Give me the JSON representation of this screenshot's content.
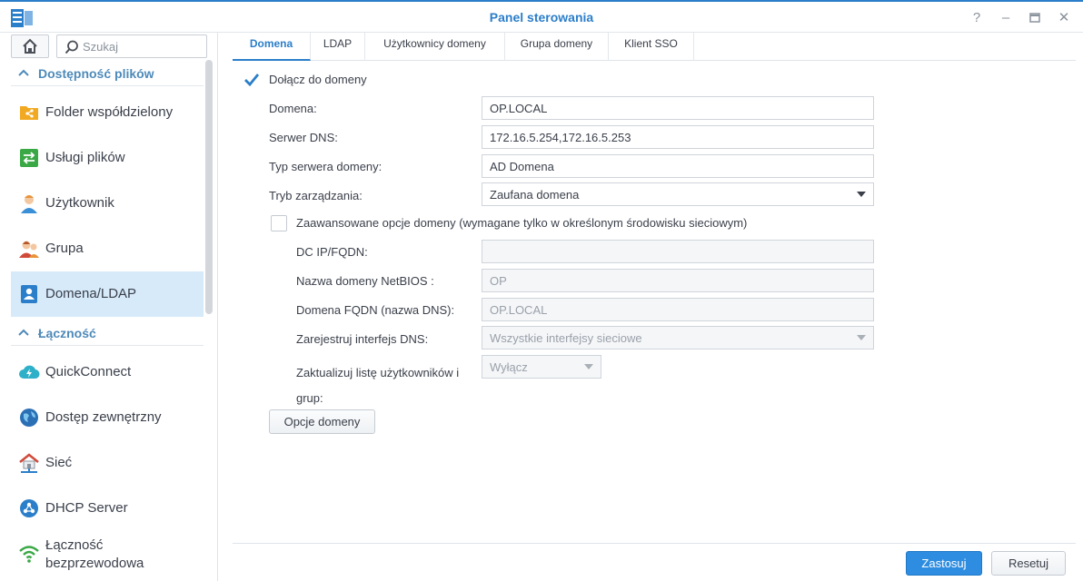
{
  "window": {
    "title": "Panel sterowania"
  },
  "colors": {
    "accent": "#2b7ec9",
    "active_bg": "#d6eaf9",
    "primary_button": "#2e8de0"
  },
  "search": {
    "placeholder": "Szukaj"
  },
  "sidebar": {
    "sections": [
      {
        "label": "Dostępność plików"
      },
      {
        "label": "Łączność"
      }
    ],
    "items": [
      {
        "label": "Folder współdzielony",
        "icon": "shared-folder-icon"
      },
      {
        "label": "Usługi plików",
        "icon": "file-services-icon"
      },
      {
        "label": "Użytkownik",
        "icon": "user-icon"
      },
      {
        "label": "Grupa",
        "icon": "group-icon"
      },
      {
        "label": "Domena/LDAP",
        "icon": "domain-ldap-icon",
        "active": true
      },
      {
        "label": "QuickConnect",
        "icon": "quickconnect-icon"
      },
      {
        "label": "Dostęp zewnętrzny",
        "icon": "external-access-icon"
      },
      {
        "label": "Sieć",
        "icon": "network-icon"
      },
      {
        "label": "DHCP Server",
        "icon": "dhcp-server-icon"
      },
      {
        "label_line1": "Łączność",
        "label_line2": "bezprzewodowa",
        "icon": "wireless-icon"
      }
    ]
  },
  "tabs": [
    {
      "label": "Domena",
      "active": true
    },
    {
      "label": "LDAP"
    },
    {
      "label": "Użytkownicy domeny"
    },
    {
      "label": "Grupa domeny"
    },
    {
      "label": "Klient SSO"
    }
  ],
  "form": {
    "join_domain": {
      "label": "Dołącz do domeny",
      "checked": true
    },
    "domain": {
      "label": "Domena:",
      "value": "OP.LOCAL"
    },
    "dns_server": {
      "label": "Serwer DNS:",
      "value": "172.16.5.254,172.16.5.253"
    },
    "domain_server_type": {
      "label": "Typ serwera domeny:",
      "value": "AD Domena"
    },
    "management_mode": {
      "label": "Tryb zarządzania:",
      "value": "Zaufana domena"
    },
    "advanced": {
      "label": "Zaawansowane opcje domeny (wymagane tylko w określonym środowisku sieciowym)",
      "checked": false
    },
    "dc_ip": {
      "label": "DC IP/FQDN:",
      "value": ""
    },
    "netbios": {
      "label": "Nazwa domeny NetBIOS :",
      "value": "OP"
    },
    "fqdn": {
      "label": "Domena FQDN (nazwa DNS):",
      "value": "OP.LOCAL"
    },
    "register_dns": {
      "label": "Zarejestruj interfejs DNS:",
      "value": "Wszystkie interfejsy sieciowe"
    },
    "update_list": {
      "label_line1": "Zaktualizuj listę użytkowników i",
      "label_line2": "grup:",
      "value": "Wyłącz"
    },
    "domain_options_button": "Opcje domeny"
  },
  "footer": {
    "apply": "Zastosuj",
    "reset": "Resetuj"
  }
}
